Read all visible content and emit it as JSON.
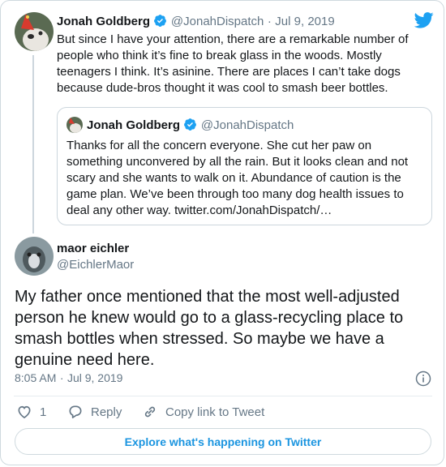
{
  "parent_tweet": {
    "author_name": "Jonah Goldberg",
    "handle": "@JonahDispatch",
    "separator": "·",
    "date": "Jul 9, 2019",
    "text": "But since I have your attention, there are a remarkable number of people who think it’s fine to break glass in the woods. Mostly teenagers I think. It’s asinine. There are places I can’t take dogs because dude-bros thought it was cool to smash beer bottles."
  },
  "quoted_tweet": {
    "author_name": "Jonah Goldberg",
    "handle": "@JonahDispatch",
    "text": "Thanks for all the concern everyone. She cut her paw on something unconvered by all the rain. But it looks clean and not scary and she wants to walk on it. Abundance of caution is the game plan. We’ve been through too many dog health issues to deal any other way. twitter.com/JonahDispatch/…"
  },
  "main_tweet": {
    "author_name": "maor eichler",
    "handle": "@EichlerMaor",
    "text": "My father once mentioned that the most well-adjusted person he knew would go to a glass-recycling place to smash bottles when stressed. So maybe we have a genuine need here.",
    "time": "8:05 AM",
    "separator": "·",
    "date": "Jul 9, 2019"
  },
  "actions": {
    "like_count": "1",
    "reply_label": "Reply",
    "copy_label": "Copy link to Tweet"
  },
  "explore_label": "Explore what's happening on Twitter",
  "colors": {
    "accent": "#1da1f2",
    "link": "#1b95e0",
    "muted": "#657786",
    "border": "#cfd9de"
  },
  "icons": [
    "twitter-bird-icon",
    "verified-badge-icon",
    "info-icon",
    "heart-icon",
    "reply-icon",
    "link-icon"
  ]
}
